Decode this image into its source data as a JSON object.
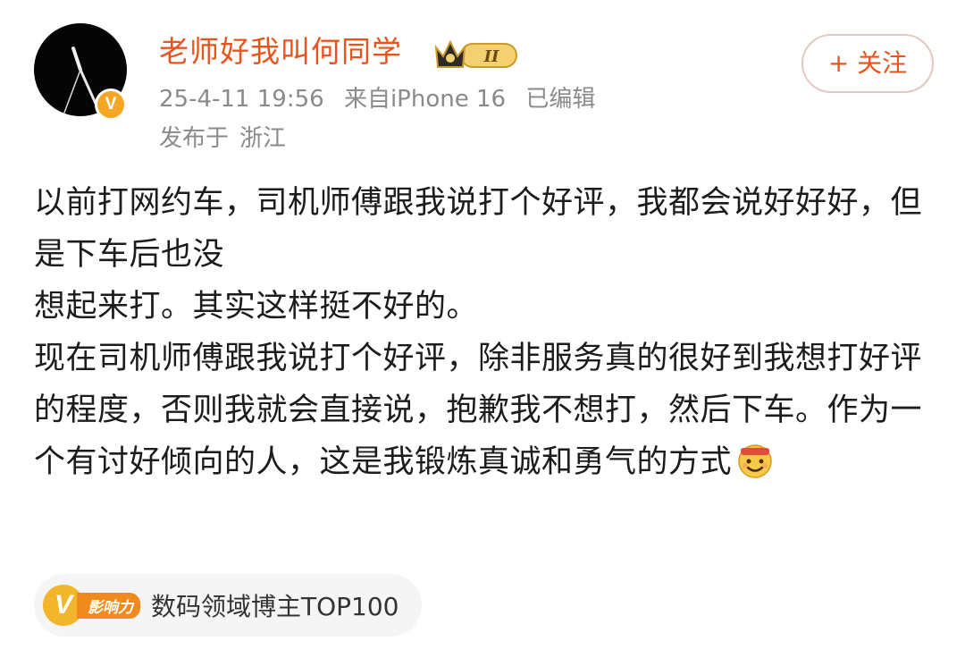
{
  "author": {
    "name": "老师好我叫何同学",
    "level_badge": "II",
    "verified_badge": "V",
    "avatar_icon": "clock-hands-avatar"
  },
  "post_meta": {
    "date": "25-4-11 19:56",
    "source": "来自iPhone 16",
    "edited": "已编辑",
    "location_prefix": "发布于",
    "location": "浙江"
  },
  "follow_button": {
    "label": "+ 关注"
  },
  "content": {
    "lines": [
      "以前打网约车，司机师傅跟我说打个好评，我都会说好好好，但是下车后也没",
      "想起来打。其实这样挺不好的。",
      "现在司机师傅跟我说打个好评，除非服务真的很好到我想打好评的程度，否则我就会直接说，抱歉我不想打，然后下车。作为一个有讨好倾向的人，这是我锻炼真诚和勇气的方式"
    ],
    "emoji": "grinning-headband-emoji"
  },
  "influence": {
    "badge_letter": "V",
    "badge_word": "影响力",
    "label": "数码领域博主TOP100"
  },
  "colors": {
    "accent": "#e8541d",
    "meta_gray": "#8a8a8a",
    "gold": "#f3b52a"
  }
}
